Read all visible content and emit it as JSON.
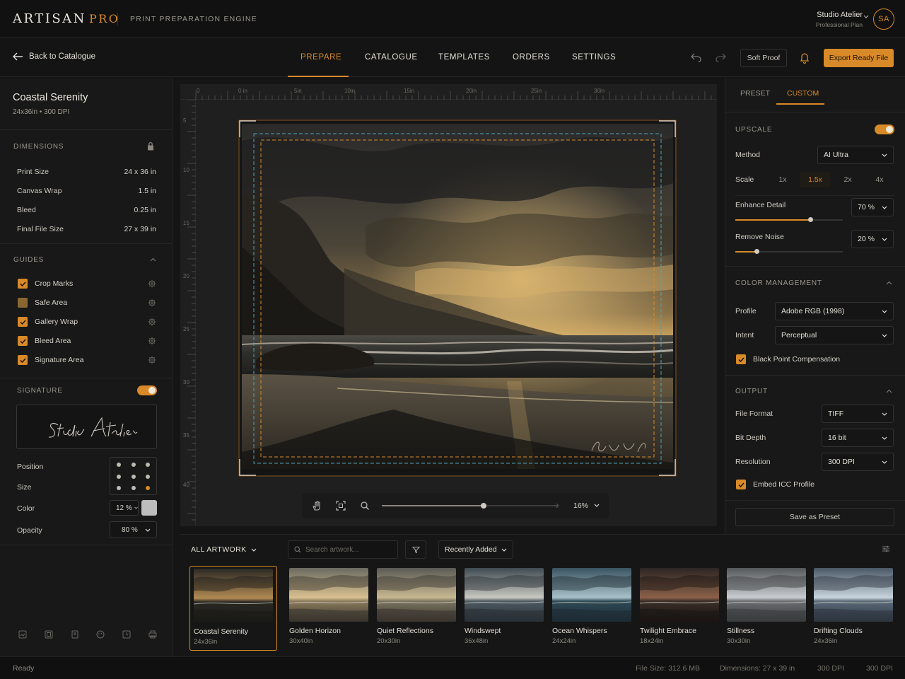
{
  "app": {
    "brand_main": "ARTISAN",
    "brand_accent": "PRO",
    "tagline": "PRINT PREPARATION ENGINE",
    "user_name": "Studio Atelier",
    "user_plan": "Professional Plan",
    "avatar_initials": "SA"
  },
  "nav": {
    "back_label": "Back to Catalogue",
    "tabs": [
      "PREPARE",
      "CATALOGUE",
      "TEMPLATES",
      "ORDERS",
      "SETTINGS"
    ],
    "active_tab": "PREPARE",
    "soft_proof": "Soft Proof",
    "export": "Export Ready File"
  },
  "project": {
    "title": "Coastal Serenity",
    "subtitle": "24x36in • 300 DPI"
  },
  "dimensions": {
    "title": "DIMENSIONS",
    "rows": [
      {
        "label": "Print Size",
        "value": "24 x 36 in"
      },
      {
        "label": "Canvas Wrap",
        "value": "1.5 in"
      },
      {
        "label": "Bleed",
        "value": "0.25 in"
      },
      {
        "label": "Final File Size",
        "value": "27 x 39 in"
      }
    ]
  },
  "guides": {
    "title": "GUIDES",
    "items": [
      {
        "label": "Crop Marks",
        "checked": true
      },
      {
        "label": "Safe Area",
        "checked": false
      },
      {
        "label": "Gallery Wrap",
        "checked": true
      },
      {
        "label": "Bleed Area",
        "checked": true
      },
      {
        "label": "Signature Area",
        "checked": true
      }
    ]
  },
  "signature": {
    "title": "SIGNATURE",
    "enabled": true,
    "script": "Studio Atelier",
    "position_label": "Position",
    "size_label": "Size",
    "color_label": "Color",
    "opacity_label": "Opacity",
    "size_value": "12 %",
    "opacity_value": "80 %",
    "color_swatch": "#bdbdbd"
  },
  "rulers": {
    "top": [
      "0",
      "0 in",
      "5in",
      "10in",
      "15in",
      "20in",
      "25in",
      "30in"
    ],
    "left": [
      "5",
      "10",
      "15",
      "20",
      "25",
      "30",
      "35",
      "40"
    ]
  },
  "zoom": {
    "value": "16%",
    "level": 0.58
  },
  "right_panel": {
    "tabs": [
      "PRESET",
      "CUSTOM"
    ],
    "active_tab": "CUSTOM",
    "upscale": {
      "title": "UPSCALE",
      "enabled": true,
      "method_label": "Method",
      "method_value": "AI Ultra",
      "scale_label": "Scale",
      "scale_options": [
        "1x",
        "1.5x",
        "2x",
        "4x"
      ],
      "scale_selected": "1.5x",
      "enhance_label": "Enhance Detail",
      "enhance_value": "70 %",
      "enhance_level": 0.7,
      "noise_label": "Remove Noise",
      "noise_value": "20 %",
      "noise_level": 0.2
    },
    "color_management": {
      "title": "COLOR MANAGEMENT",
      "profile_label": "Profile",
      "profile_value": "Adobe RGB (1998)",
      "intent_label": "Intent",
      "intent_value": "Perceptual",
      "bpc_label": "Black Point Compensation",
      "bpc_checked": true
    },
    "output": {
      "title": "OUTPUT",
      "format_label": "File Format",
      "format_value": "TIFF",
      "depth_label": "Bit Depth",
      "depth_value": "16 bit",
      "resolution_label": "Resolution",
      "resolution_value": "300 DPI",
      "icc_label": "Embed ICC Profile",
      "icc_checked": true
    },
    "save_preset": "Save as Preset"
  },
  "artwork_strip": {
    "title": "ALL ARTWORK",
    "search_placeholder": "Search artwork...",
    "sort_value": "Recently Added",
    "items": [
      {
        "title": "Coastal Serenity",
        "size": "24x36in",
        "selected": true
      },
      {
        "title": "Golden Horizon",
        "size": "30x40in",
        "selected": false
      },
      {
        "title": "Quiet Reflections",
        "size": "20x30in",
        "selected": false
      },
      {
        "title": "Windswept",
        "size": "36x48in",
        "selected": false
      },
      {
        "title": "Ocean Whispers",
        "size": "24x24in",
        "selected": false
      },
      {
        "title": "Twilight Embrace",
        "size": "18x24in",
        "selected": false
      },
      {
        "title": "Stillness",
        "size": "30x30in",
        "selected": false
      },
      {
        "title": "Drifting Clouds",
        "size": "24x36in",
        "selected": false
      }
    ]
  },
  "status": {
    "ready": "Ready",
    "file_size": "File Size: 312.6 MB",
    "dimensions": "Dimensions: 27 x 39 in",
    "dpi1": "300 DPI",
    "dpi2": "300 DPI"
  },
  "colors": {
    "accent": "#d98a28",
    "background": "#151515",
    "panel": "#181818",
    "guide_cyan": "#4fa3b8"
  }
}
